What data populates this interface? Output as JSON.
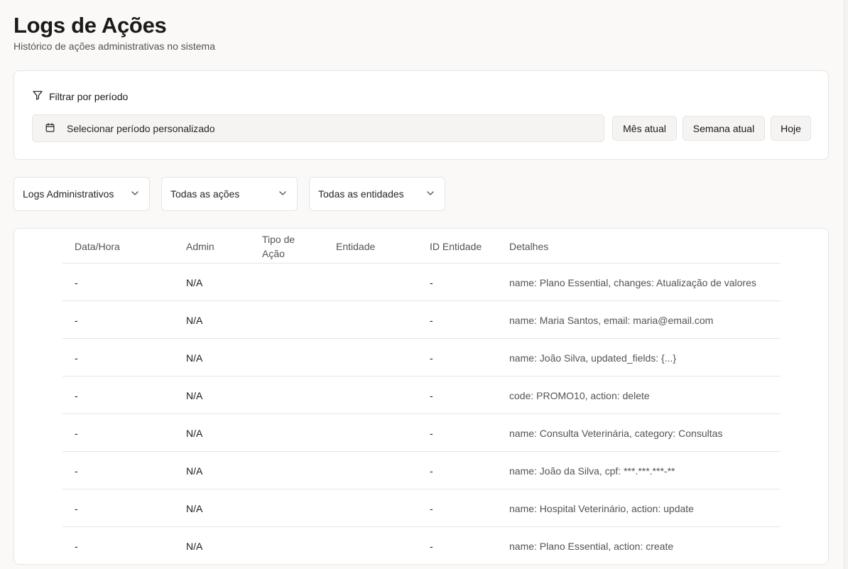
{
  "header": {
    "title": "Logs de Ações",
    "subtitle": "Histórico de ações administrativas no sistema"
  },
  "period_filter": {
    "heading": "Filtrar por período",
    "heading_icon": "filter-icon",
    "picker_icon": "calendar-icon",
    "picker_label": "Selecionar período personalizado",
    "quick_buttons": [
      "Mês atual",
      "Semana atual",
      "Hoje"
    ]
  },
  "selects": {
    "log_type": "Logs Administrativos",
    "action": "Todas as ações",
    "entity": "Todas as entidades"
  },
  "table": {
    "columns": [
      "Data/Hora",
      "Admin",
      "Tipo de Ação",
      "Entidade",
      "ID Entidade",
      "Detalhes"
    ],
    "rows": [
      {
        "datetime": "-",
        "admin": "N/A",
        "action_type": "",
        "entity": "",
        "entity_id": "-",
        "details": "name: Plano Essential, changes: Atualização de valores"
      },
      {
        "datetime": "-",
        "admin": "N/A",
        "action_type": "",
        "entity": "",
        "entity_id": "-",
        "details": "name: Maria Santos, email: maria@email.com"
      },
      {
        "datetime": "-",
        "admin": "N/A",
        "action_type": "",
        "entity": "",
        "entity_id": "-",
        "details": "name: João Silva, updated_fields: {...}"
      },
      {
        "datetime": "-",
        "admin": "N/A",
        "action_type": "",
        "entity": "",
        "entity_id": "-",
        "details": "code: PROMO10, action: delete"
      },
      {
        "datetime": "-",
        "admin": "N/A",
        "action_type": "",
        "entity": "",
        "entity_id": "-",
        "details": "name: Consulta Veterinária, category: Consultas"
      },
      {
        "datetime": "-",
        "admin": "N/A",
        "action_type": "",
        "entity": "",
        "entity_id": "-",
        "details": "name: João da Silva, cpf: ***.***.***-**"
      },
      {
        "datetime": "-",
        "admin": "N/A",
        "action_type": "",
        "entity": "",
        "entity_id": "-",
        "details": "name: Hospital Veterinário, action: update"
      },
      {
        "datetime": "-",
        "admin": "N/A",
        "action_type": "",
        "entity": "",
        "entity_id": "-",
        "details": "name: Plano Essential, action: create"
      }
    ]
  }
}
